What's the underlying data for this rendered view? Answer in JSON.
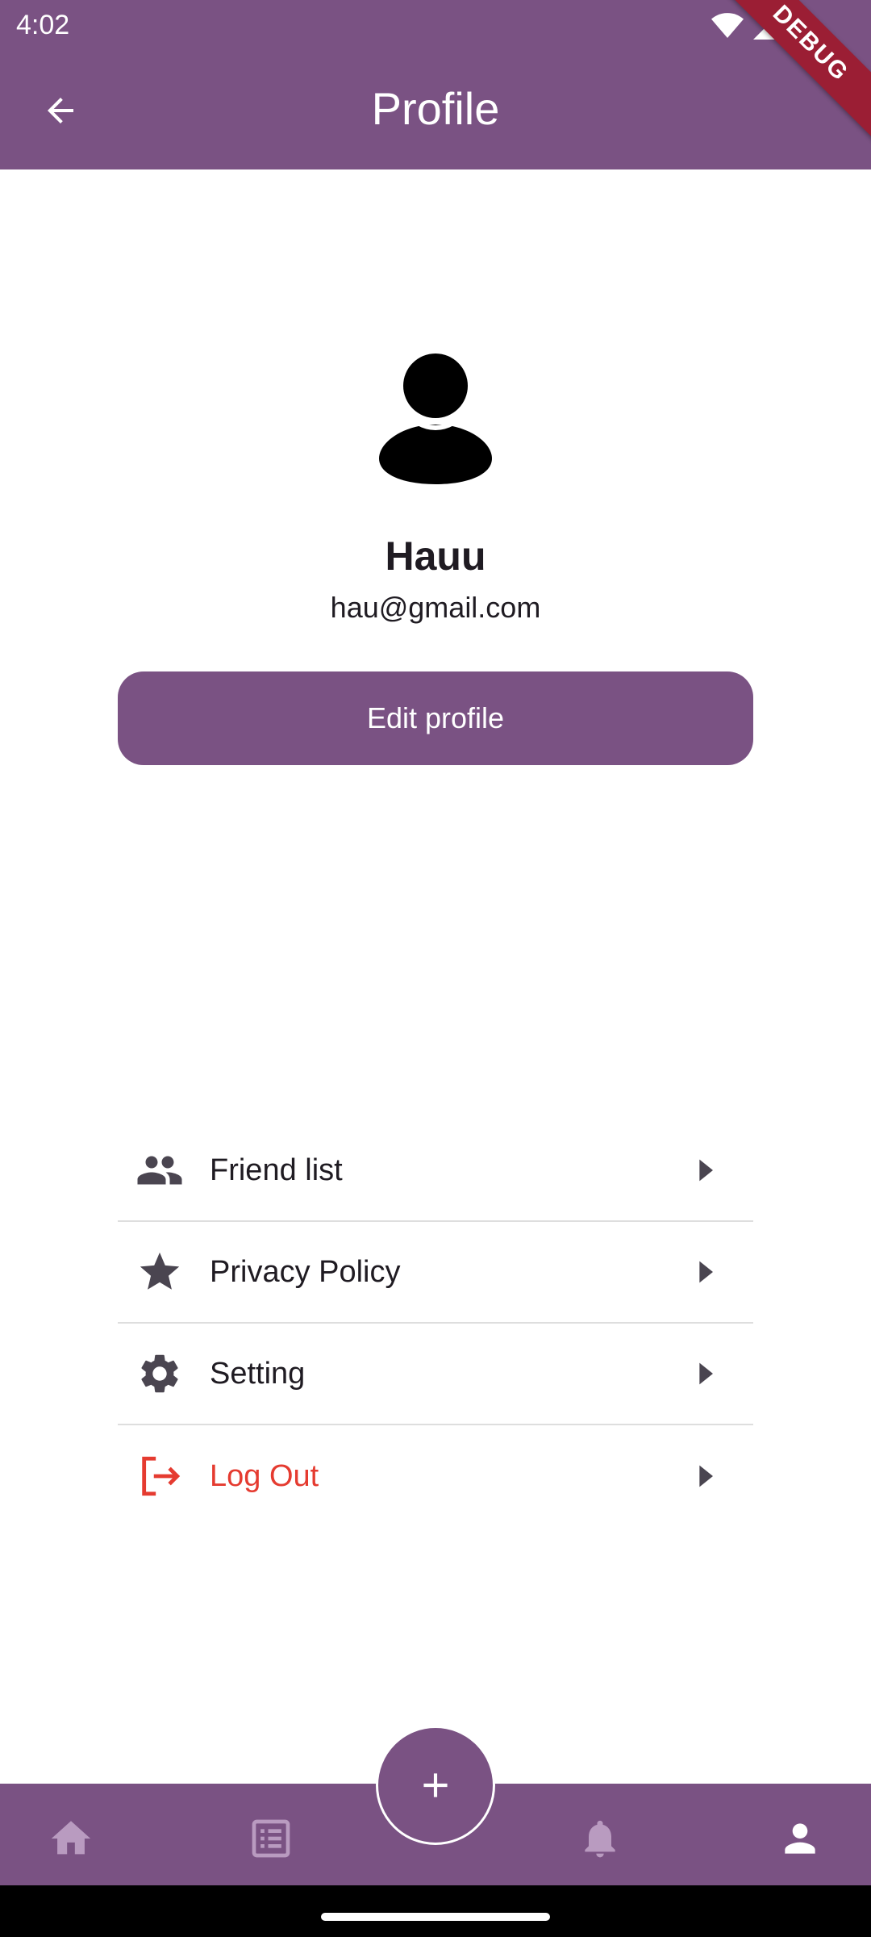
{
  "status": {
    "time": "4:02"
  },
  "debug_banner": "DEBUG",
  "app_bar": {
    "title": "Profile",
    "back_icon": "arrow-back-icon"
  },
  "profile": {
    "name": "Hauu",
    "email": "hau@gmail.com",
    "edit_label": "Edit profile",
    "avatar_icon": "person-icon"
  },
  "menu": {
    "items": [
      {
        "label": "Friend list",
        "icon": "people-icon"
      },
      {
        "label": "Privacy Policy",
        "icon": "star-icon"
      },
      {
        "label": "Setting",
        "icon": "gear-icon"
      },
      {
        "label": "Log Out",
        "icon": "logout-icon"
      }
    ]
  },
  "bottom_nav": {
    "items": [
      "home-icon",
      "list-icon",
      "add-icon",
      "bell-icon",
      "person-icon"
    ],
    "active": "person-icon"
  },
  "colors": {
    "primary": "#7a5283",
    "logout": "#e53b30",
    "icon": "#4a4550",
    "nav_inactive": "#b99bc0"
  }
}
